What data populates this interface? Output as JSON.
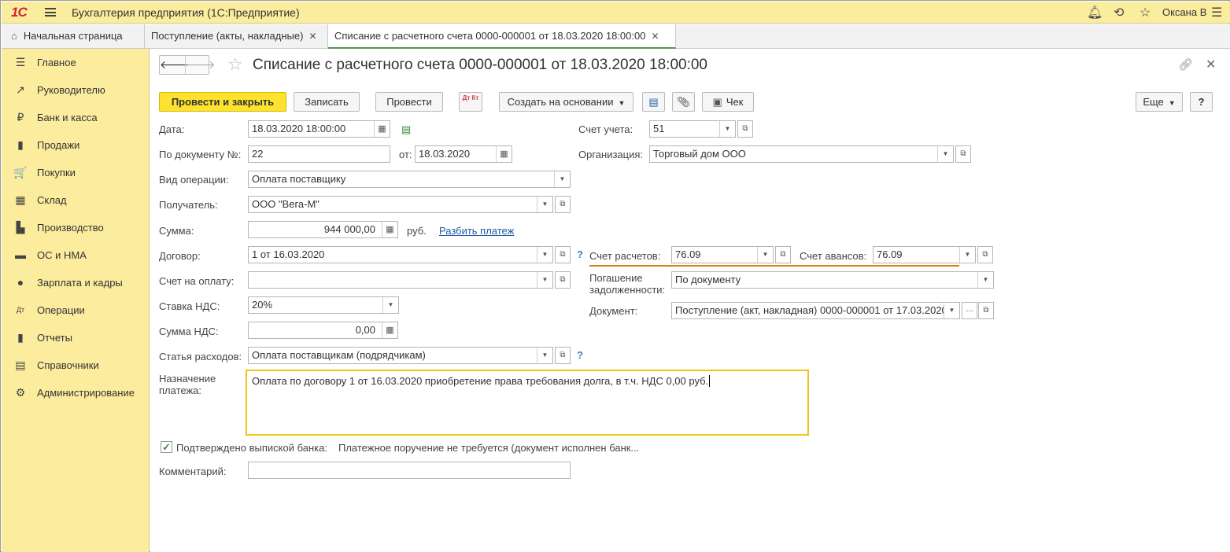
{
  "titlebar": {
    "logo": "1С",
    "app_title": "Бухгалтерия предприятия  (1С:Предприятие)",
    "user": "Оксана В"
  },
  "tabs": [
    {
      "label": "Начальная страница"
    },
    {
      "label": "Поступление (акты, накладные)"
    },
    {
      "label": "Списание с расчетного счета 0000-000001 от 18.03.2020 18:00:00"
    }
  ],
  "sidebar": {
    "items": [
      {
        "label": "Главное",
        "icon": "☰"
      },
      {
        "label": "Руководителю",
        "icon": "↗"
      },
      {
        "label": "Банк и касса",
        "icon": "₽"
      },
      {
        "label": "Продажи",
        "icon": "▮"
      },
      {
        "label": "Покупки",
        "icon": "🛒"
      },
      {
        "label": "Склад",
        "icon": "▦"
      },
      {
        "label": "Производство",
        "icon": "▙"
      },
      {
        "label": "ОС и НМА",
        "icon": "▬"
      },
      {
        "label": "Зарплата и кадры",
        "icon": "●"
      },
      {
        "label": "Операции",
        "icon": "Дт"
      },
      {
        "label": "Отчеты",
        "icon": "▮"
      },
      {
        "label": "Справочники",
        "icon": "▤"
      },
      {
        "label": "Администрирование",
        "icon": "⚙"
      }
    ]
  },
  "document": {
    "title": "Списание с расчетного счета 0000-000001 от 18.03.2020 18:00:00"
  },
  "toolbar": {
    "post_close": "Провести и закрыть",
    "save": "Записать",
    "post": "Провести",
    "dtkt": "Дт Кт",
    "create_based": "Создать на основании",
    "check": "Чек",
    "more": "Еще",
    "help": "?"
  },
  "form": {
    "date_label": "Дата:",
    "date_value": "18.03.2020 18:00:00",
    "docnum_label": "По документу №:",
    "docnum_value": "22",
    "from_label": "от:",
    "from_value": "18.03.2020",
    "optype_label": "Вид операции:",
    "optype_value": "Оплата поставщику",
    "recipient_label": "Получатель:",
    "recipient_value": "ООО \"Вега-М\"",
    "sum_label": "Сумма:",
    "sum_value": "944 000,00",
    "currency": "руб.",
    "split_link": "Разбить платеж",
    "contract_label": "Договор:",
    "contract_value": "1 от 16.03.2020",
    "invoice_label": "Счет на оплату:",
    "invoice_value": "",
    "vat_rate_label": "Ставка НДС:",
    "vat_rate_value": "20%",
    "vat_sum_label": "Сумма НДС:",
    "vat_sum_value": "0,00",
    "expense_label": "Статья расходов:",
    "expense_value": "Оплата поставщикам (подрядчикам)",
    "purpose_label_1": "Назначение",
    "purpose_label_2": "платежа:",
    "purpose_value": "Оплата по договору 1 от 16.03.2020 приобретение права требования долга, в т.ч. НДС 0,00 руб.",
    "confirmed_label": "Подтверждено выпиской банка:",
    "confirmed_note": "Платежное поручение не требуется (документ исполнен банк...",
    "comment_label": "Комментарий:",
    "comment_value": "",
    "account_label": "Счет учета:",
    "account_value": "51",
    "org_label": "Организация:",
    "org_value": "Торговый дом ООО",
    "settle_label": "Счет расчетов:",
    "settle_value": "76.09",
    "advance_label": "Счет авансов:",
    "advance_value": "76.09",
    "repay_label_1": "Погашение",
    "repay_label_2": "задолженности:",
    "repay_value": "По документу",
    "docref_label": "Документ:",
    "docref_value": "Поступление (акт, накладная) 0000-000001 от 17.03.2020"
  },
  "colors": {
    "accent_yellow": "#fde32d",
    "sidebar_bg": "#fbec9e",
    "link_blue": "#1e5ba8",
    "highlight_orange": "#e07b16"
  }
}
